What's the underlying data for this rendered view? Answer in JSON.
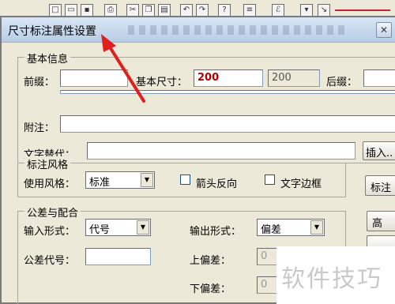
{
  "dialog": {
    "title": "尺寸标注属性设置",
    "basic_info": {
      "legend": "基本信息",
      "prefix_label": "前缀：",
      "prefix_value": "",
      "basic_size_label": "基本尺寸：",
      "basic_size_value": "200",
      "basic_size_display": "200",
      "suffix_label": "后缀：",
      "suffix_value": "",
      "note_label": "附注：",
      "note_value": "",
      "text_replace_label": "文字替代：",
      "text_replace_value": "",
      "insert_button": "插入.."
    },
    "style_group": {
      "legend": "标注风格",
      "use_style_label": "使用风格：",
      "use_style_value": "标准",
      "reverse_arrow_label": "箭头反向",
      "text_border_label": "文字边框",
      "style_button": "标注"
    },
    "tolerance": {
      "legend": "公差与配合",
      "input_form_label": "输入形式：",
      "input_form_value": "代号",
      "output_form_label": "输出形式：",
      "output_form_value": "偏差",
      "tolerance_code_label": "公差代号：",
      "tolerance_code_value": "",
      "upper_dev_label": "上偏差：",
      "upper_dev_value": "0",
      "lower_dev_label": "下偏差：",
      "lower_dev_value": "0",
      "advanced_button": "高"
    }
  },
  "watermark": {
    "text": "软件技巧"
  },
  "colors": {
    "annotation_arrow": "#e02020",
    "basic_size_text": "#b40000"
  }
}
